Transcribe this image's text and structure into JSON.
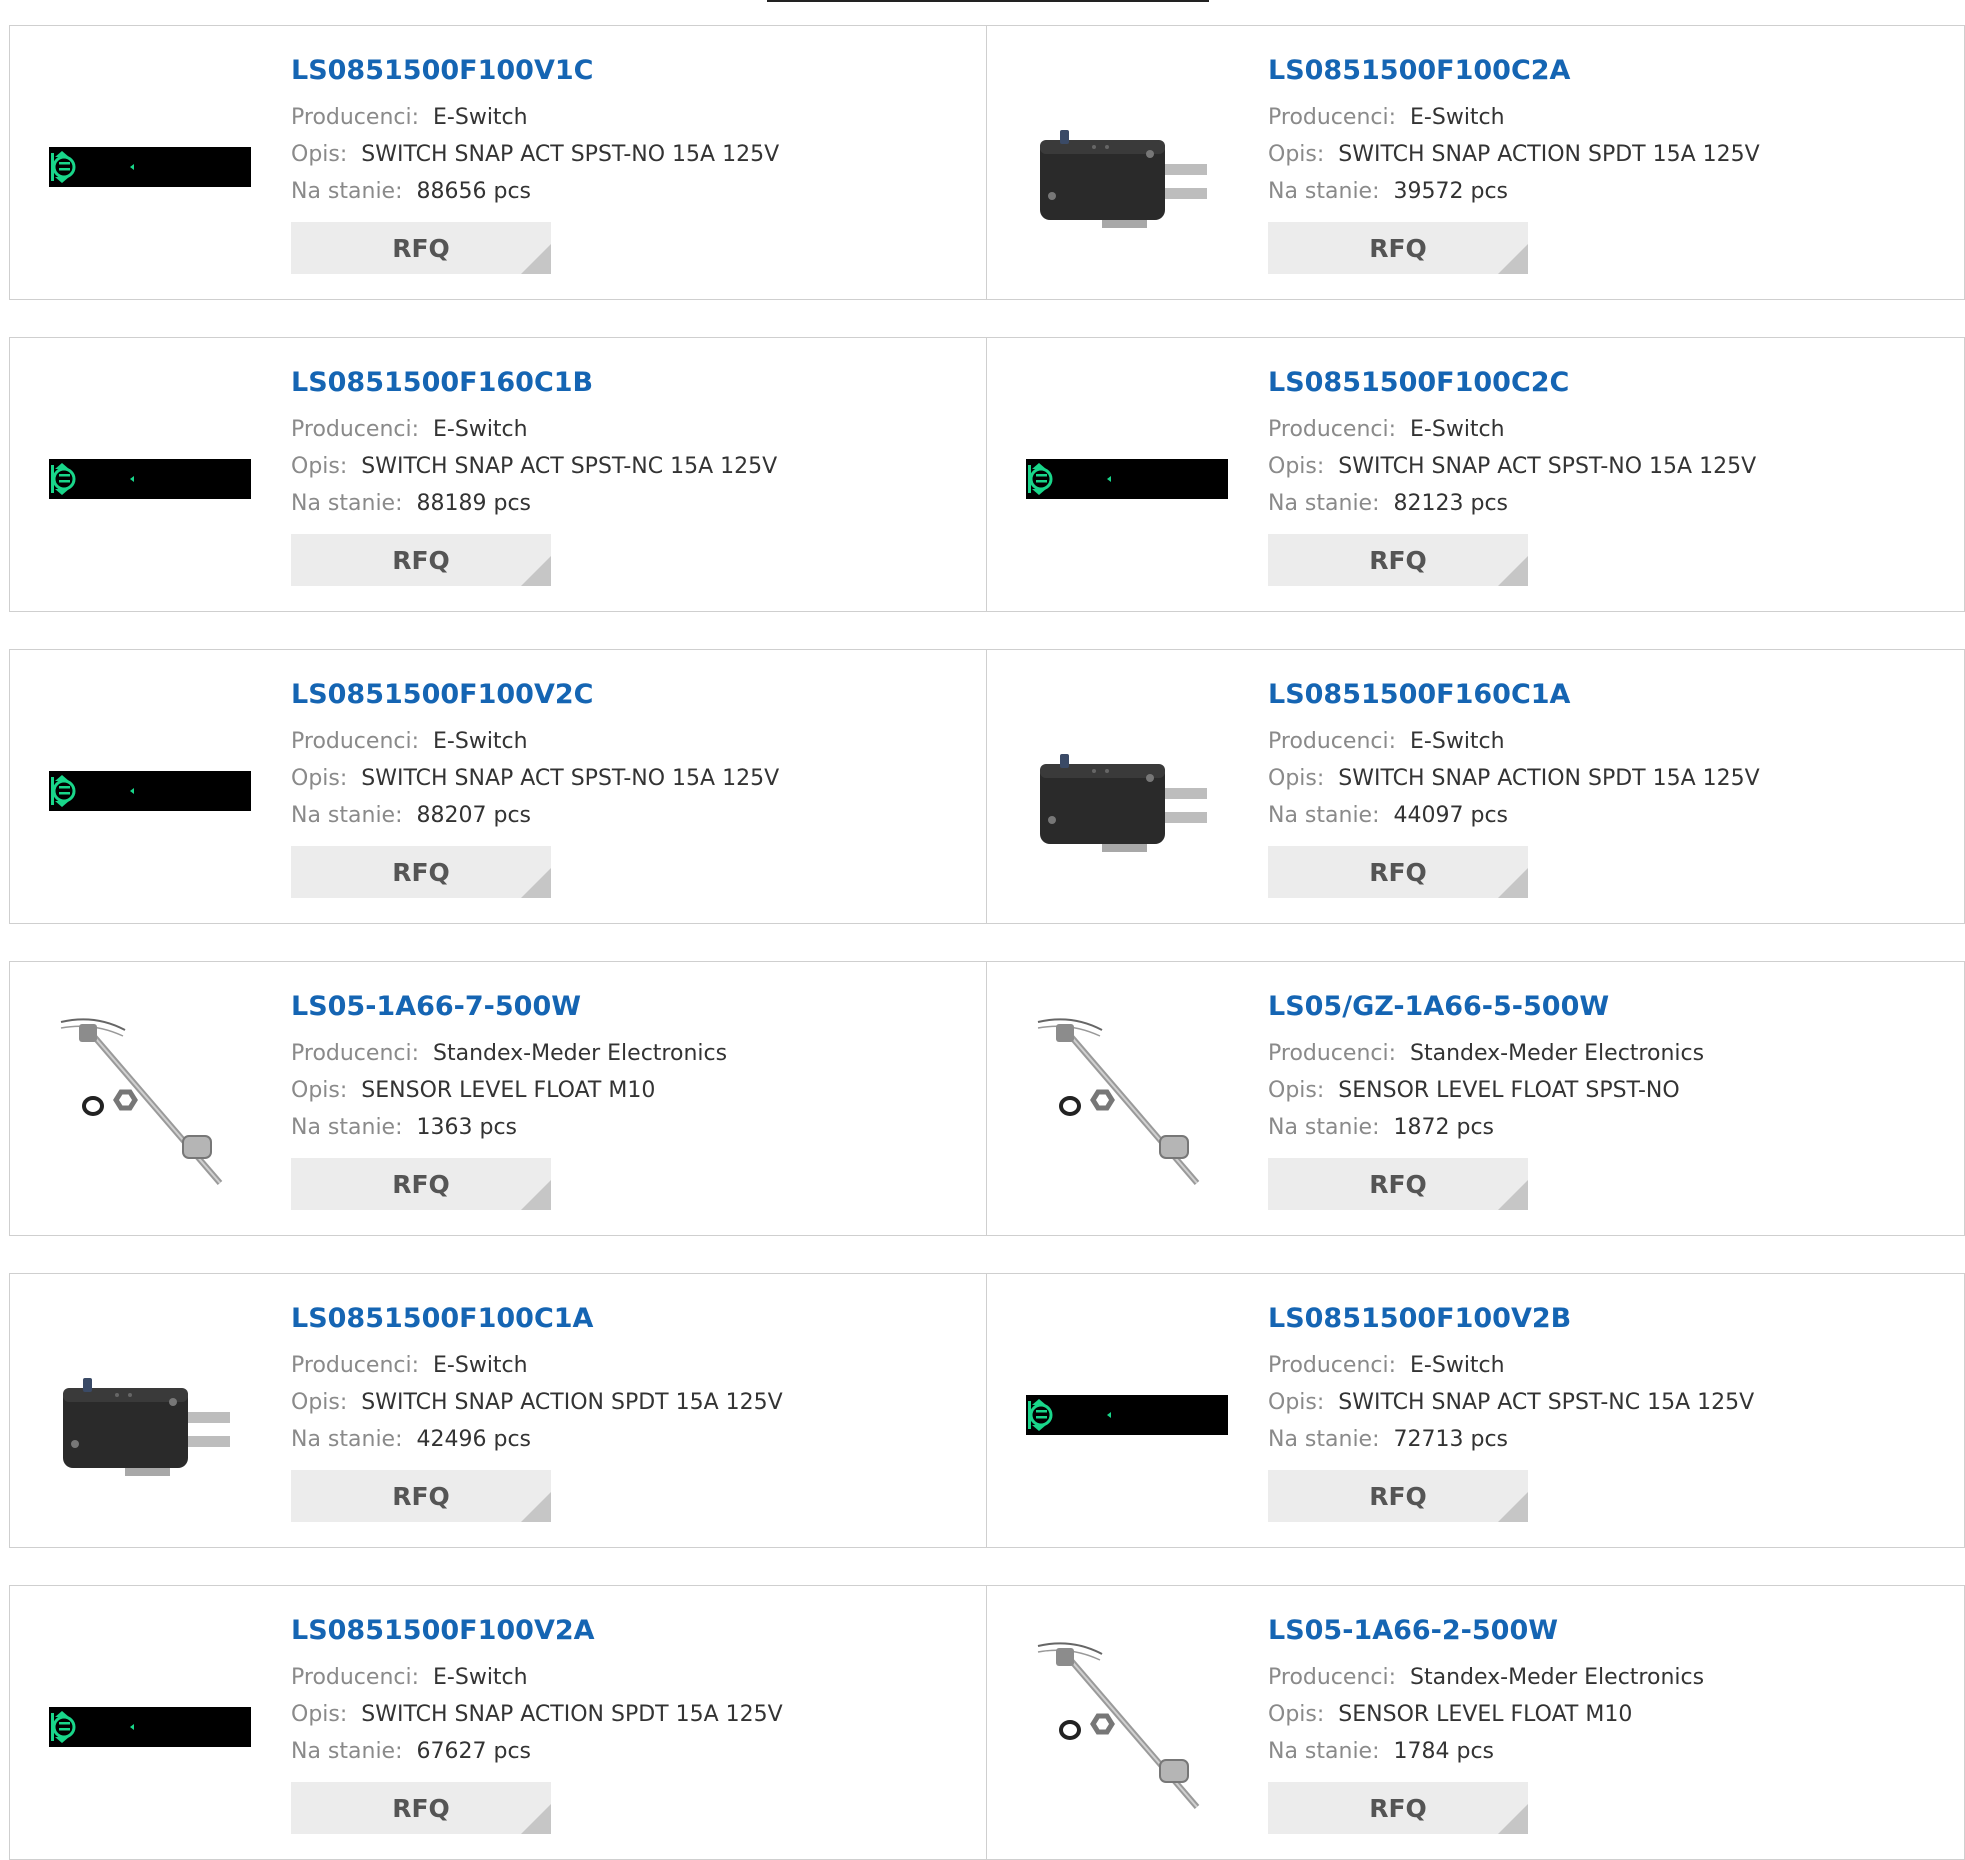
{
  "labels": {
    "manufacturer": "Producenci:",
    "description": "Opis:",
    "stock": "Na stanie:"
  },
  "products": [
    {
      "part": "LS0851500F100V1C",
      "manufacturer": "E-Switch",
      "description": "SWITCH SNAP ACT SPST-NO 15A 125V",
      "stock": "88656 pcs",
      "button": "RFQ",
      "image": "placeholder-icon"
    },
    {
      "part": "LS0851500F100C2A",
      "manufacturer": "E-Switch",
      "description": "SWITCH SNAP ACTION SPDT 15A 125V",
      "stock": "39572 pcs",
      "button": "RFQ",
      "image": "microswitch-photo"
    },
    {
      "part": "LS0851500F160C1B",
      "manufacturer": "E-Switch",
      "description": "SWITCH SNAP ACT SPST-NC 15A 125V",
      "stock": "88189 pcs",
      "button": "RFQ",
      "image": "placeholder-icon"
    },
    {
      "part": "LS0851500F100C2C",
      "manufacturer": "E-Switch",
      "description": "SWITCH SNAP ACT SPST-NO 15A 125V",
      "stock": "82123 pcs",
      "button": "RFQ",
      "image": "placeholder-icon"
    },
    {
      "part": "LS0851500F100V2C",
      "manufacturer": "E-Switch",
      "description": "SWITCH SNAP ACT SPST-NO 15A 125V",
      "stock": "88207 pcs",
      "button": "RFQ",
      "image": "placeholder-icon"
    },
    {
      "part": "LS0851500F160C1A",
      "manufacturer": "E-Switch",
      "description": "SWITCH SNAP ACTION SPDT 15A 125V",
      "stock": "44097 pcs",
      "button": "RFQ",
      "image": "microswitch-photo"
    },
    {
      "part": "LS05-1A66-7-500W",
      "manufacturer": "Standex-Meder Electronics",
      "description": "SENSOR LEVEL FLOAT M10",
      "stock": "1363 pcs",
      "button": "RFQ",
      "image": "float-sensor-photo"
    },
    {
      "part": "LS05/GZ-1A66-5-500W",
      "manufacturer": "Standex-Meder Electronics",
      "description": "SENSOR LEVEL FLOAT SPST-NO",
      "stock": "1872 pcs",
      "button": "RFQ",
      "image": "float-sensor-photo"
    },
    {
      "part": "LS0851500F100C1A",
      "manufacturer": "E-Switch",
      "description": "SWITCH SNAP ACTION SPDT 15A 125V",
      "stock": "42496 pcs",
      "button": "RFQ",
      "image": "microswitch-photo"
    },
    {
      "part": "LS0851500F100V2B",
      "manufacturer": "E-Switch",
      "description": "SWITCH SNAP ACT SPST-NC 15A 125V",
      "stock": "72713 pcs",
      "button": "RFQ",
      "image": "placeholder-icon"
    },
    {
      "part": "LS0851500F100V2A",
      "manufacturer": "E-Switch",
      "description": "SWITCH SNAP ACTION SPDT 15A 125V",
      "stock": "67627 pcs",
      "button": "RFQ",
      "image": "placeholder-icon"
    },
    {
      "part": "LS05-1A66-2-500W",
      "manufacturer": "Standex-Meder Electronics",
      "description": "SENSOR LEVEL FLOAT M10",
      "stock": "1784 pcs",
      "button": "RFQ",
      "image": "float-sensor-photo"
    }
  ],
  "colors": {
    "link": "#1565b3",
    "label": "#8a8a8a",
    "value": "#333333",
    "button_bg": "#ececec",
    "accent_green": "#19d68a"
  }
}
